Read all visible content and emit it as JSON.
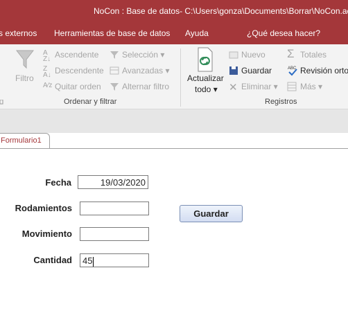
{
  "window": {
    "title": "NoCon : Base de datos- C:\\Users\\gonza\\Documents\\Borrar\\NoCon.ac"
  },
  "menu": {
    "items": [
      "s externos",
      "Herramientas de base de datos",
      "Ayuda"
    ],
    "tell_me": "¿Qué desea hacer?"
  },
  "ribbon": {
    "sort_filter": {
      "label": "Ordenar y filtrar",
      "filter": "Filtro",
      "ascending": "Ascendente",
      "descending": "Descendente",
      "remove_sort": "Quitar orden",
      "selection": "Selección",
      "advanced": "Avanzadas",
      "toggle_filter": "Alternar filtro"
    },
    "records": {
      "label": "Registros",
      "refresh_line1": "Actualizar",
      "refresh_line2": "todo",
      "new": "Nuevo",
      "save": "Guardar",
      "delete": "Eliminar",
      "totals": "Totales",
      "spelling": "Revisión orto",
      "more": "Más"
    }
  },
  "document_tab": {
    "label": "Formulario1"
  },
  "form": {
    "fecha_label": "Fecha",
    "fecha_value": "19/03/2020",
    "rodamientos_label": "Rodamientos",
    "rodamientos_value": "",
    "movimiento_label": "Movimiento",
    "movimiento_value": "",
    "cantidad_label": "Cantidad",
    "cantidad_value": "45",
    "save_button": "Guardar"
  }
}
